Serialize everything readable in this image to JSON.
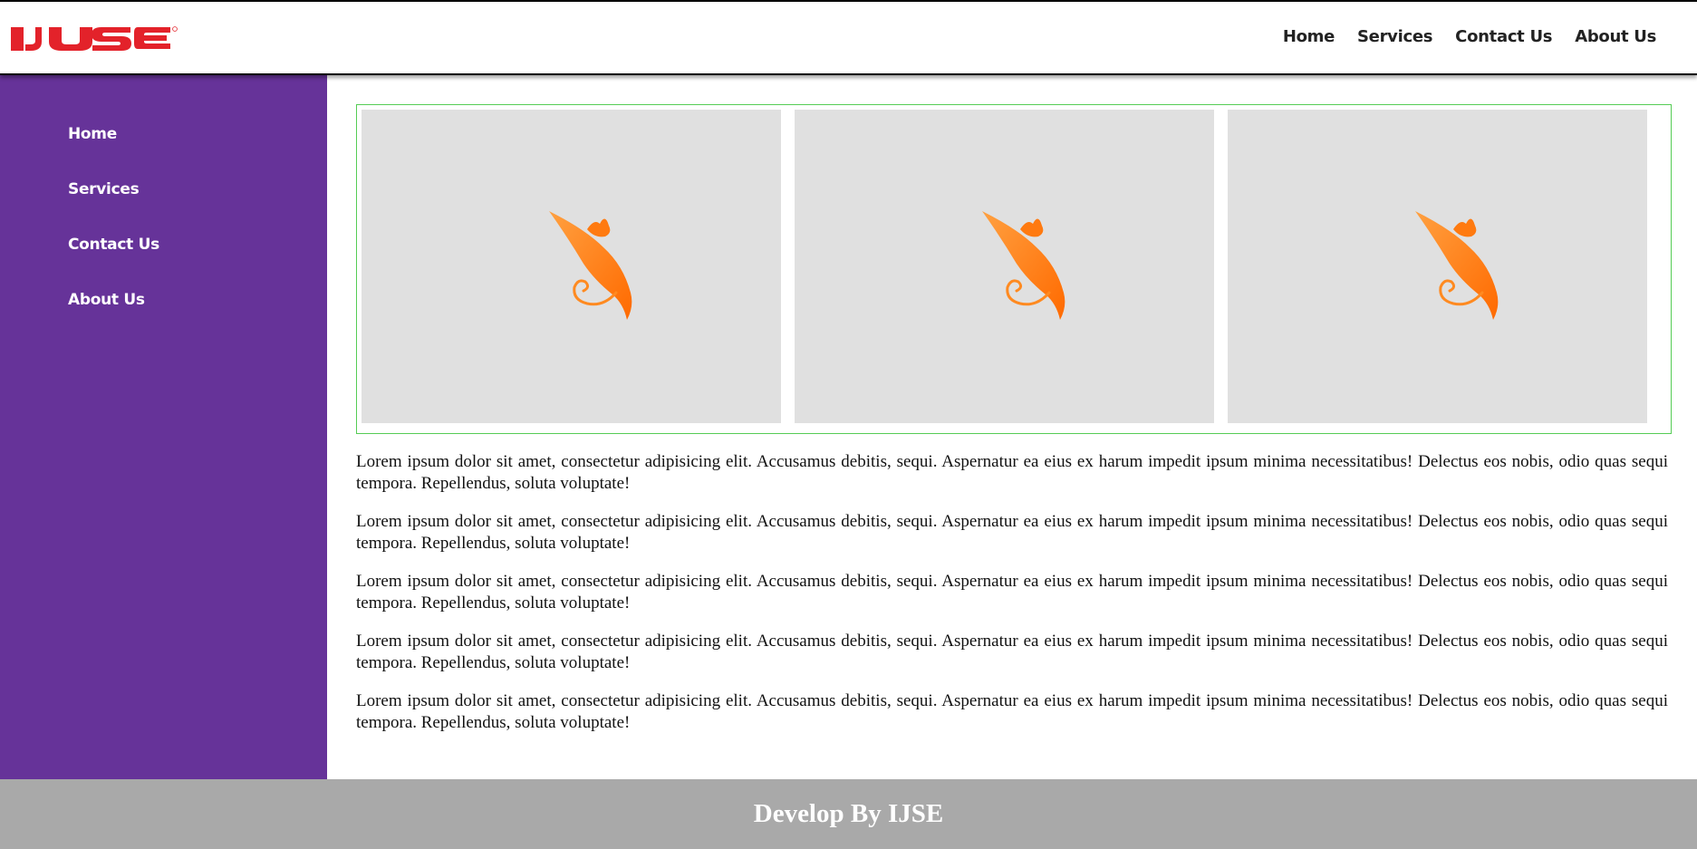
{
  "brand": {
    "logo_text": "IJSE",
    "logo_color": "#e3222a"
  },
  "topnav": {
    "items": [
      {
        "label": "Home"
      },
      {
        "label": "Services"
      },
      {
        "label": "Contact Us"
      },
      {
        "label": "About Us"
      }
    ]
  },
  "sidebar": {
    "background": "#663399",
    "items": [
      {
        "label": "Home"
      },
      {
        "label": "Services"
      },
      {
        "label": "Contact Us"
      },
      {
        "label": "About Us"
      }
    ]
  },
  "gallery": {
    "border_color": "#55cc55",
    "images": [
      {
        "icon": "fire-logo-image"
      },
      {
        "icon": "fire-logo-image"
      },
      {
        "icon": "fire-logo-image"
      }
    ]
  },
  "content": {
    "paragraphs": [
      "Lorem ipsum dolor sit amet, consectetur adipisicing elit. Accusamus debitis, sequi. Aspernatur ea eius ex harum impedit ipsum minima necessitatibus! Delectus eos nobis, odio quas sequi tempora. Repellendus, soluta voluptate!",
      "Lorem ipsum dolor sit amet, consectetur adipisicing elit. Accusamus debitis, sequi. Aspernatur ea eius ex harum impedit ipsum minima necessitatibus! Delectus eos nobis, odio quas sequi tempora. Repellendus, soluta voluptate!",
      "Lorem ipsum dolor sit amet, consectetur adipisicing elit. Accusamus debitis, sequi. Aspernatur ea eius ex harum impedit ipsum minima necessitatibus! Delectus eos nobis, odio quas sequi tempora. Repellendus, soluta voluptate!",
      "Lorem ipsum dolor sit amet, consectetur adipisicing elit. Accusamus debitis, sequi. Aspernatur ea eius ex harum impedit ipsum minima necessitatibus! Delectus eos nobis, odio quas sequi tempora. Repellendus, soluta voluptate!",
      "Lorem ipsum dolor sit amet, consectetur adipisicing elit. Accusamus debitis, sequi. Aspernatur ea eius ex harum impedit ipsum minima necessitatibus! Delectus eos nobis, odio quas sequi tempora. Repellendus, soluta voluptate!"
    ]
  },
  "footer": {
    "text": "Develop By IJSE",
    "background": "#a9a9a9"
  }
}
